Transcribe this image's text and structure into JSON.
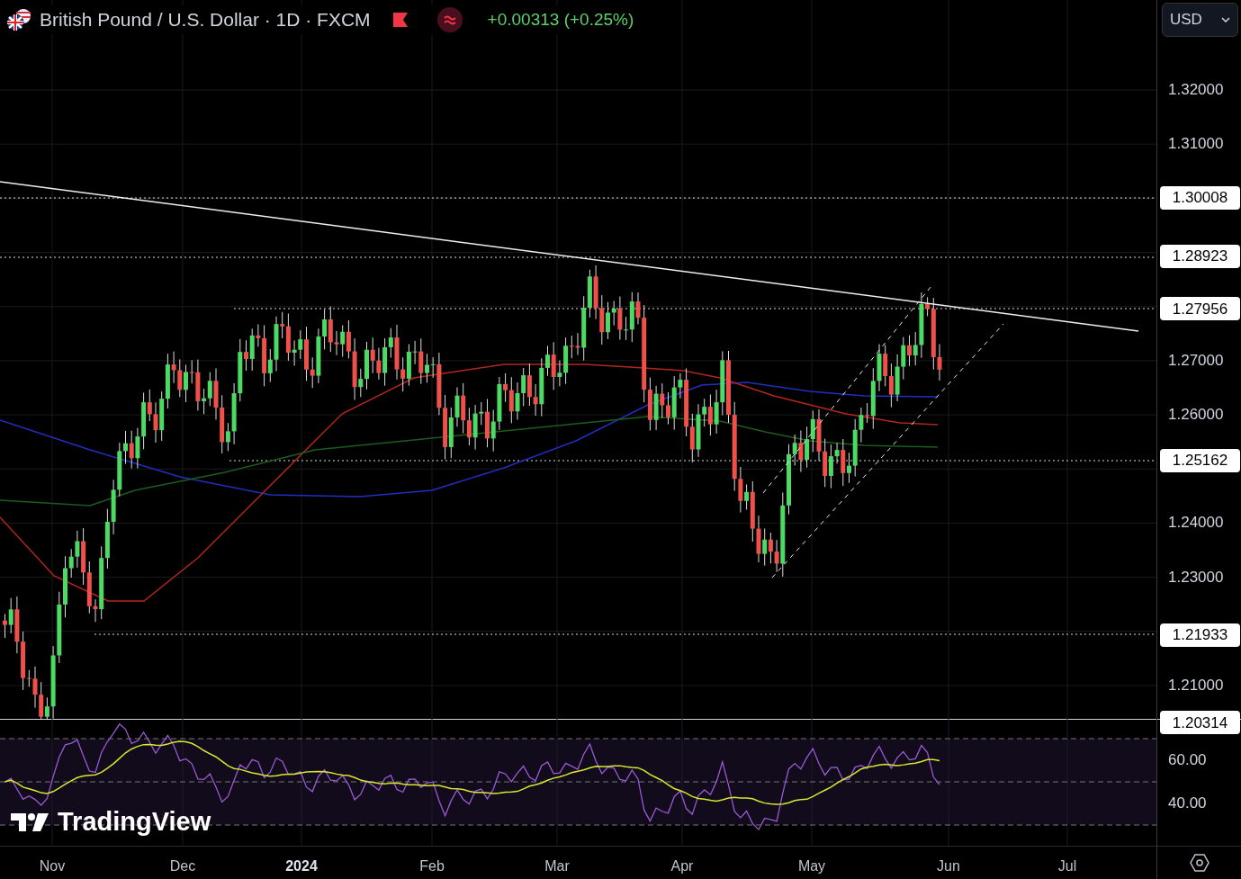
{
  "header": {
    "title": "British Pound / U.S. Dollar · 1D · FXCM",
    "change": "+0.00313 (+0.25%)"
  },
  "currency_select": {
    "value": "USD"
  },
  "price_axis": [
    {
      "label": "1.32000",
      "kind": "tick"
    },
    {
      "label": "1.31000",
      "kind": "tick"
    },
    {
      "label": "1.30008",
      "kind": "marker"
    },
    {
      "label": "1.28923",
      "kind": "marker"
    },
    {
      "label": "1.27956",
      "kind": "marker"
    },
    {
      "label": "1.27000",
      "kind": "tick"
    },
    {
      "label": "1.26000",
      "kind": "tick"
    },
    {
      "label": "1.25162",
      "kind": "marker"
    },
    {
      "label": "1.24000",
      "kind": "tick"
    },
    {
      "label": "1.23000",
      "kind": "tick"
    },
    {
      "label": "1.21933",
      "kind": "marker"
    },
    {
      "label": "1.21000",
      "kind": "tick"
    },
    {
      "label": "1.20314",
      "kind": "marker"
    }
  ],
  "rsi_axis": [
    "60.00",
    "40.00"
  ],
  "logo": {
    "text": "TradingView"
  },
  "time_axis": [
    {
      "label": "Nov",
      "kind": "month"
    },
    {
      "label": "Dec",
      "kind": "month"
    },
    {
      "label": "2024",
      "kind": "year"
    },
    {
      "label": "Feb",
      "kind": "month"
    },
    {
      "label": "Mar",
      "kind": "month"
    },
    {
      "label": "Apr",
      "kind": "month"
    },
    {
      "label": "May",
      "kind": "month"
    },
    {
      "label": "Jun",
      "kind": "month"
    },
    {
      "label": "Jul",
      "kind": "month"
    }
  ]
}
